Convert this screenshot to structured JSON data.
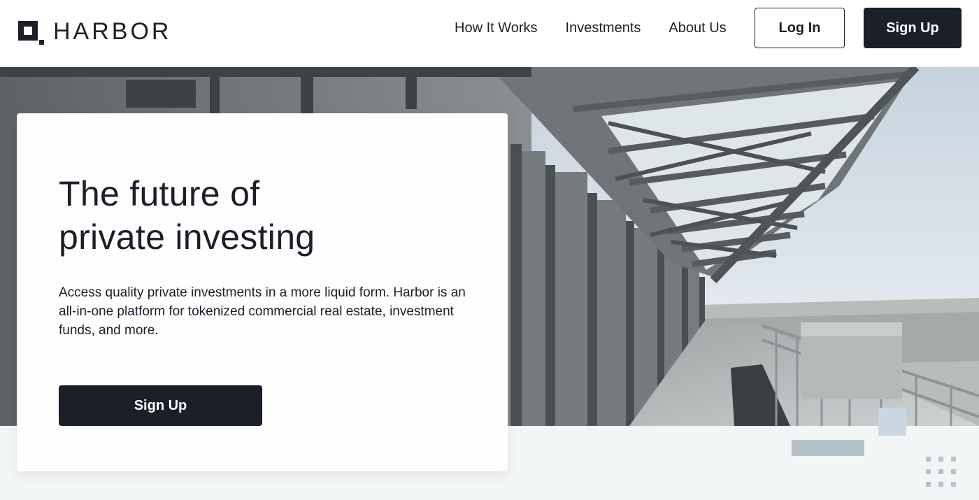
{
  "brand": {
    "name": "HARBOR",
    "icon": "harbor-logo-icon"
  },
  "nav": {
    "links": [
      "How It Works",
      "Investments",
      "About Us"
    ],
    "login_label": "Log In",
    "signup_label": "Sign Up"
  },
  "hero": {
    "title_line1": "The future of",
    "title_line2": "private investing",
    "description": "Access quality private investments in a more liquid form. Harbor is an all-in-one platform for tokenized commercial real estate, investment funds, and more.",
    "cta_label": "Sign Up"
  },
  "colors": {
    "primary_dark": "#1b1f28",
    "accent_light_blue": "#c9d8e0",
    "accent_gray": "#b5c3c6",
    "band_background": "#f3f6f7"
  }
}
